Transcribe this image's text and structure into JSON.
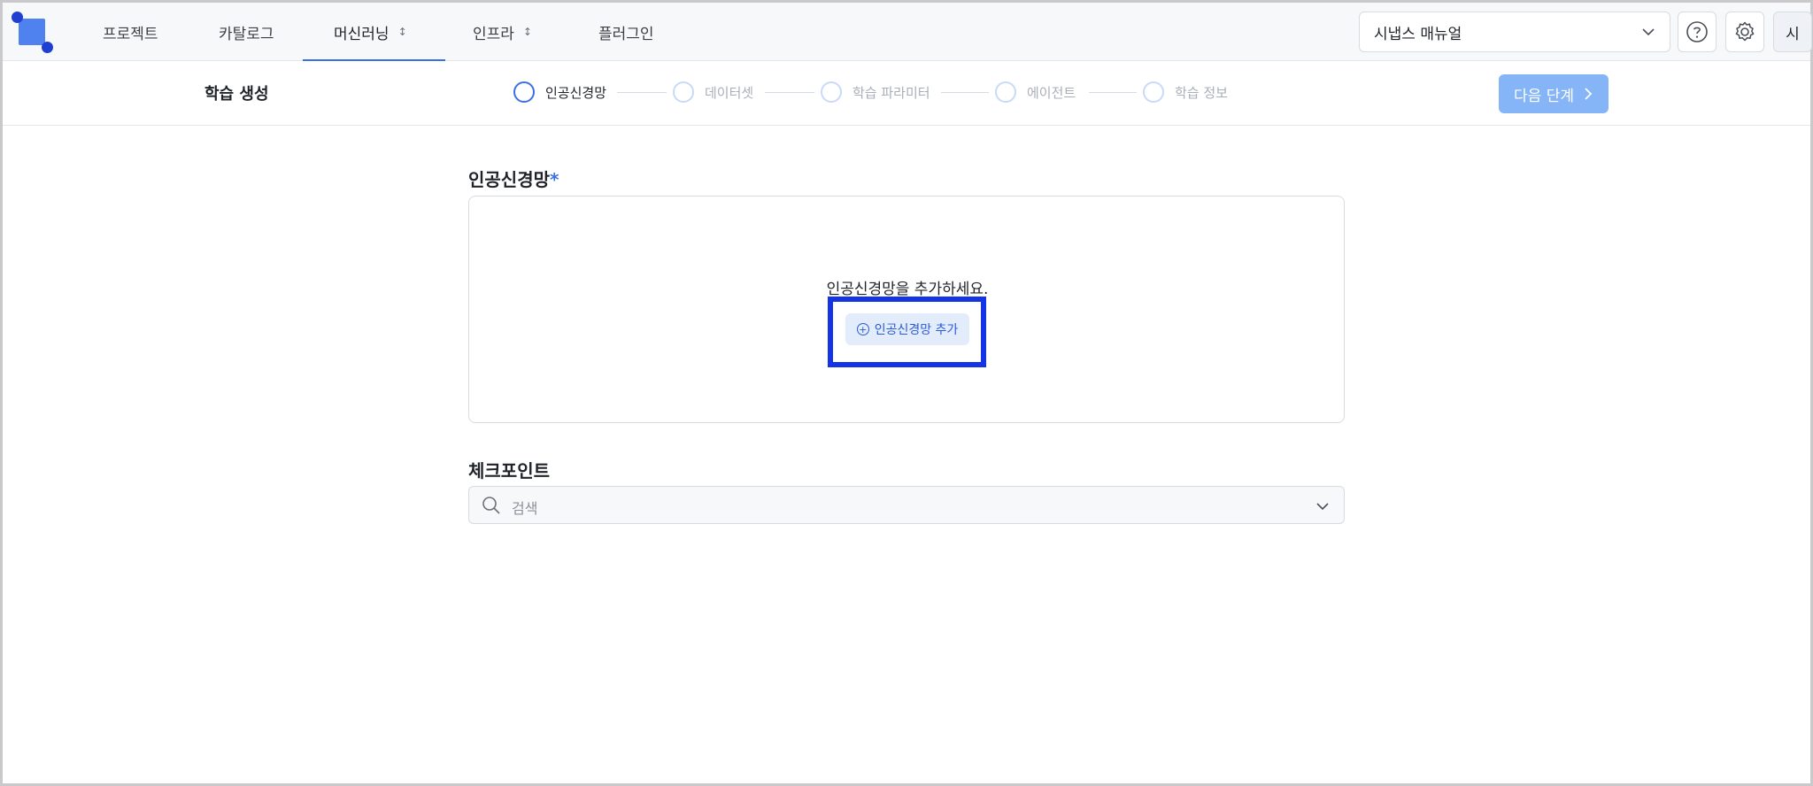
{
  "nav": {
    "items": [
      {
        "label": "프로젝트",
        "has_menu": false
      },
      {
        "label": "카탈로그",
        "has_menu": false
      },
      {
        "label": "머신러닝",
        "has_menu": true,
        "active": true
      },
      {
        "label": "인프라",
        "has_menu": true
      },
      {
        "label": "플러그인",
        "has_menu": false
      }
    ],
    "menu_icon": "↕",
    "manual_select": {
      "value": "시냅스 매뉴얼",
      "icon": "chevron-down-icon"
    },
    "help_icon": "help-circle-icon",
    "settings_icon": "gear-icon",
    "avatar_label": "시"
  },
  "stepbar": {
    "title": "학습 생성",
    "steps": [
      {
        "label": "인공신경망",
        "active": true
      },
      {
        "label": "데이터셋",
        "active": false
      },
      {
        "label": "학습 파라미터",
        "active": false
      },
      {
        "label": "에이전트",
        "active": false
      },
      {
        "label": "학습 정보",
        "active": false
      }
    ],
    "next_button": {
      "label": "다음 단계",
      "icon": "chevron-right-icon"
    }
  },
  "main": {
    "neural_net": {
      "title": "인공신경망",
      "required_mark": "*",
      "empty_message": "인공신경망을 추가하세요.",
      "add_button": {
        "label": "인공신경망 추가",
        "icon": "plus-circle-icon"
      }
    },
    "checkpoint": {
      "title": "체크포인트",
      "placeholder": "검색",
      "icon": "search-icon",
      "dropdown_icon": "chevron-down-icon"
    }
  },
  "colors": {
    "accent": "#3a6fe6",
    "next_button_bg": "#86b5f7",
    "highlight_border": "#1434e6"
  }
}
